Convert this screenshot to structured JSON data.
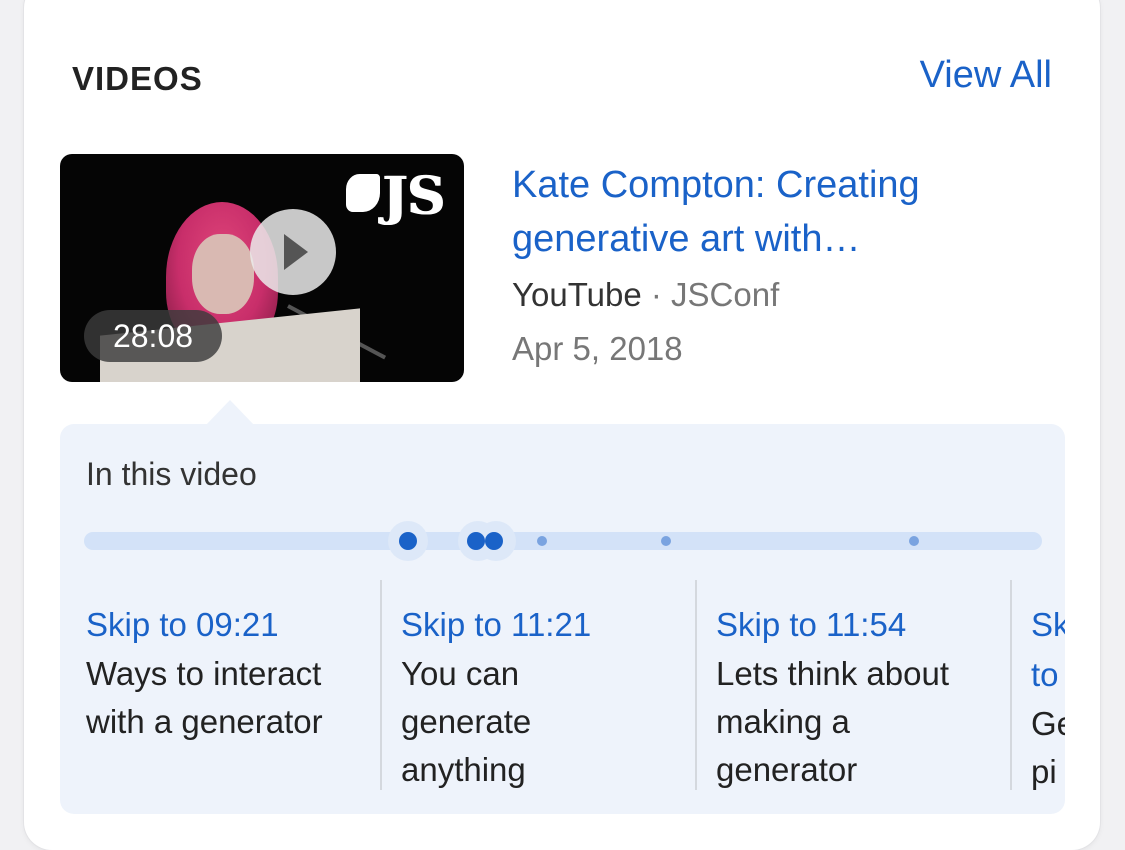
{
  "section": {
    "title": "VIDEOS",
    "view_all": "View All"
  },
  "video": {
    "duration": "28:08",
    "title_line1": "Kate Compton: Creating",
    "title_line2": "generative art with…",
    "source": "YouTube",
    "separator": " · ",
    "channel": "JSConf",
    "date": "Apr 5, 2018",
    "thumbnail_logo": "JS"
  },
  "moments": {
    "heading": "In this video",
    "items": [
      {
        "skip": "Skip to 09:21",
        "desc": "Ways to interact with a generator"
      },
      {
        "skip": "Skip to 11:21",
        "desc": "You can generate anything"
      },
      {
        "skip": "Skip to 11:54",
        "desc": "Lets think about making a generator"
      },
      {
        "skip": "Skip to",
        "desc": "Ge pi"
      }
    ]
  },
  "colors": {
    "link": "#1a62c8",
    "panel_bg": "#eef3fb",
    "track": "#d3e2f8"
  }
}
